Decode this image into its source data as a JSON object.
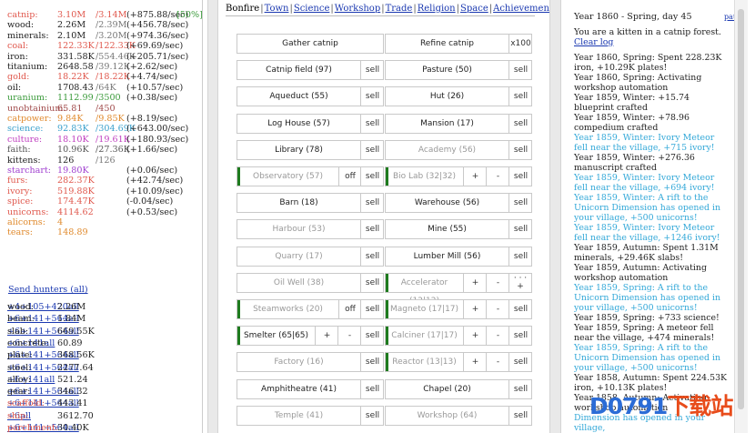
{
  "resources": [
    {
      "name": "catnip",
      "value": "3.10M",
      "max": "/3.14M",
      "rate": "(+875.88/sec)",
      "pct": "[50%]",
      "color": "#e0584d"
    },
    {
      "name": "wood",
      "value": "2.26M",
      "max": "/2.39M",
      "rate": "(+456.78/sec)",
      "pct": "",
      "color": "#222"
    },
    {
      "name": "minerals",
      "value": "2.10M",
      "max": "/3.20M",
      "rate": "(+974.36/sec)",
      "pct": "",
      "color": "#222"
    },
    {
      "name": "coal",
      "value": "122.33K",
      "max": "/122.33K",
      "rate": "(+69.69/sec)",
      "pct": "",
      "color": "#e0584d"
    },
    {
      "name": "iron",
      "value": "331.58K",
      "max": "/554.46K",
      "rate": "(+205.71/sec)",
      "pct": "",
      "color": "#222"
    },
    {
      "name": "titanium",
      "value": "2648.58",
      "max": "/39.12K",
      "rate": "(+2.62/sec)",
      "pct": "",
      "color": "#222"
    },
    {
      "name": "gold",
      "value": "18.22K",
      "max": "/18.22K",
      "rate": "(+4.74/sec)",
      "pct": "",
      "color": "#e0584d"
    },
    {
      "name": "oil",
      "value": "1708.43",
      "max": "/64K",
      "rate": "(+10.57/sec)",
      "pct": "",
      "color": "#222"
    },
    {
      "name": "uranium",
      "value": "1112.99",
      "max": "/3500",
      "rate": "(+0.38/sec)",
      "pct": "",
      "color": "#3a9a3a"
    },
    {
      "name": "unobtainium",
      "value": "65.81",
      "max": "/450",
      "rate": "",
      "pct": "",
      "color": "#a04a4a"
    },
    {
      "name": "catpower",
      "value": "9.84K",
      "max": "/9.85K",
      "rate": "(+8.19/sec)",
      "pct": "",
      "color": "#e08a2d"
    },
    {
      "name": "science",
      "value": "92.83K",
      "max": "/304.69K",
      "rate": "(+643.00/sec)",
      "pct": "",
      "color": "#3aa0cc"
    },
    {
      "name": "culture",
      "value": "18.10K",
      "max": "/19.61K",
      "rate": "(+180.93/sec)",
      "pct": "",
      "color": "#c040c0"
    },
    {
      "name": "faith",
      "value": "10.96K",
      "max": "/27.36K",
      "rate": "(+1.66/sec)",
      "pct": "",
      "color": "#555"
    },
    {
      "name": "kittens",
      "value": "126",
      "max": "/126",
      "rate": "",
      "pct": "",
      "color": "#222"
    },
    {
      "name": "starchart",
      "value": "19.80K",
      "max": "",
      "rate": "(+0.06/sec)",
      "pct": "",
      "color": "#a040d0"
    },
    {
      "name": "furs",
      "value": "282.37K",
      "max": "",
      "rate": "(+42.74/sec)",
      "pct": "",
      "color": "#e0584d"
    },
    {
      "name": "ivory",
      "value": "519.88K",
      "max": "",
      "rate": "(+10.09/sec)",
      "pct": "",
      "color": "#e0584d"
    },
    {
      "name": "spice",
      "value": "174.47K",
      "max": "",
      "rate": "(-0.04/sec)",
      "pct": "",
      "color": "#e0584d"
    },
    {
      "name": "unicorns",
      "value": "4114.62",
      "max": "",
      "rate": "(+0.53/sec)",
      "pct": "",
      "color": "#e0584d"
    },
    {
      "name": "alicorns",
      "value": "4",
      "max": "",
      "rate": "",
      "pct": "",
      "color": "#e08a2d"
    },
    {
      "name": "tears",
      "value": "148.89",
      "max": "",
      "rate": "",
      "pct": "",
      "color": "#e08a2d"
    }
  ],
  "send_hunters": "Send hunters (all)",
  "crafted": [
    {
      "name": "wood",
      "value": "2.26M",
      "a1": "+4",
      "a2": "+105",
      "a3": "+420",
      "a4": "all",
      "color": "#222"
    },
    {
      "name": "beam",
      "value": "1.84M",
      "a1": "+6",
      "a2": "+141",
      "a3": "+564",
      "a4": "all",
      "color": "#222"
    },
    {
      "name": "slab",
      "value": "669.55K",
      "a1": "+6",
      "a2": "+141",
      "a3": "+564",
      "a4": "all",
      "color": "#222"
    },
    {
      "name": "concrete",
      "value": "60.89",
      "a1": "+6",
      "a2": "+141",
      "a3": "",
      "a4": "all",
      "color": "#222"
    },
    {
      "name": "plate",
      "value": "368.56K",
      "a1": "+6",
      "a2": "+141",
      "a3": "+564",
      "a4": "all",
      "color": "#222"
    },
    {
      "name": "steel",
      "value": "2277.64",
      "a1": "+6",
      "a2": "+141",
      "a3": "+564",
      "a4": "all",
      "color": "#222"
    },
    {
      "name": "alloy",
      "value": "521.24",
      "a1": "+6",
      "a2": "+141",
      "a3": "",
      "a4": "all",
      "color": "#222"
    },
    {
      "name": "gear",
      "value": "346.32",
      "a1": "+6",
      "a2": "+141",
      "a3": "+564",
      "a4": "all",
      "color": "#222"
    },
    {
      "name": "scaffold",
      "value": "443.41",
      "a1": "+6",
      "a2": "+141",
      "a3": "+564",
      "a4": "all",
      "color": "#e0584d"
    },
    {
      "name": "ship",
      "value": "3612.70",
      "a1": "+6",
      "a2": "",
      "a3": "",
      "a4": "all",
      "color": "#e0584d"
    },
    {
      "name": "parchment",
      "value": "30.40K",
      "a1": "+6",
      "a2": "+141",
      "a3": "+564",
      "a4": "all",
      "color": "#e0584d"
    }
  ],
  "tabs": [
    "Bonfire",
    "Town",
    "Science",
    "Workshop",
    "Trade",
    "Religion",
    "Space",
    "Achievements"
  ],
  "buildings": [
    {
      "label": "Gather catnip",
      "col": 0,
      "row": 0,
      "dis": false,
      "bar": false,
      "ctl": []
    },
    {
      "label": "Refine catnip",
      "col": 1,
      "row": 0,
      "dis": false,
      "bar": false,
      "ctl": [
        "x100"
      ]
    },
    {
      "label": "Catnip field (97)",
      "col": 0,
      "row": 1,
      "dis": false,
      "bar": false,
      "ctl": [
        "sell"
      ]
    },
    {
      "label": "Pasture (50)",
      "col": 1,
      "row": 1,
      "dis": false,
      "bar": false,
      "ctl": [
        "sell"
      ]
    },
    {
      "label": "Aqueduct (55)",
      "col": 0,
      "row": 2,
      "dis": false,
      "bar": false,
      "ctl": [
        "sell"
      ]
    },
    {
      "label": "Hut (26)",
      "col": 1,
      "row": 2,
      "dis": false,
      "bar": false,
      "ctl": [
        "sell"
      ]
    },
    {
      "label": "Log House (57)",
      "col": 0,
      "row": 3,
      "dis": false,
      "bar": false,
      "ctl": [
        "sell"
      ]
    },
    {
      "label": "Mansion (17)",
      "col": 1,
      "row": 3,
      "dis": false,
      "bar": false,
      "ctl": [
        "sell"
      ]
    },
    {
      "label": "Library (78)",
      "col": 0,
      "row": 4,
      "dis": false,
      "bar": false,
      "ctl": [
        "sell"
      ]
    },
    {
      "label": "Academy (56)",
      "col": 1,
      "row": 4,
      "dis": true,
      "bar": false,
      "ctl": [
        "sell"
      ]
    },
    {
      "label": "Observatory (57)",
      "col": 0,
      "row": 5,
      "dis": true,
      "bar": true,
      "ctl": [
        "off",
        "sell"
      ]
    },
    {
      "label": "Bio Lab (32|32)",
      "col": 1,
      "row": 5,
      "dis": true,
      "bar": true,
      "ctl": [
        "+",
        "-",
        "sell"
      ]
    },
    {
      "label": "Barn (18)",
      "col": 0,
      "row": 6,
      "dis": false,
      "bar": false,
      "ctl": [
        "sell"
      ]
    },
    {
      "label": "Warehouse (56)",
      "col": 1,
      "row": 6,
      "dis": false,
      "bar": false,
      "ctl": [
        "sell"
      ]
    },
    {
      "label": "Harbour (53)",
      "col": 0,
      "row": 7,
      "dis": true,
      "bar": false,
      "ctl": [
        "sell"
      ]
    },
    {
      "label": "Mine (55)",
      "col": 1,
      "row": 7,
      "dis": false,
      "bar": false,
      "ctl": [
        "sell"
      ]
    },
    {
      "label": "Quarry (17)",
      "col": 0,
      "row": 8,
      "dis": true,
      "bar": false,
      "ctl": [
        "sell"
      ]
    },
    {
      "label": "Lumber Mill (56)",
      "col": 1,
      "row": 8,
      "dis": false,
      "bar": false,
      "ctl": [
        "sell"
      ]
    },
    {
      "label": "Oil Well (38)",
      "col": 0,
      "row": 9,
      "dis": true,
      "bar": false,
      "ctl": [
        "sell"
      ]
    },
    {
      "label": "Accelerator (12|12)",
      "col": 1,
      "row": 9,
      "dis": true,
      "bar": true,
      "ctl": [
        "+",
        "-",
        "· · · +"
      ]
    },
    {
      "label": "Steamworks (20)",
      "col": 0,
      "row": 10,
      "dis": true,
      "bar": true,
      "ctl": [
        "off",
        "sell"
      ]
    },
    {
      "label": "Magneto (17|17)",
      "col": 1,
      "row": 10,
      "dis": true,
      "bar": true,
      "ctl": [
        "+",
        "-",
        "sell"
      ]
    },
    {
      "label": "Smelter (65|65)",
      "col": 0,
      "row": 11,
      "dis": false,
      "bar": true,
      "ctl": [
        "+",
        "-",
        "sell"
      ]
    },
    {
      "label": "Calciner (17|17)",
      "col": 1,
      "row": 11,
      "dis": true,
      "bar": true,
      "ctl": [
        "+",
        "-",
        "sell"
      ]
    },
    {
      "label": "Factory (16)",
      "col": 0,
      "row": 12,
      "dis": true,
      "bar": false,
      "ctl": [
        "sell"
      ]
    },
    {
      "label": "Reactor (13|13)",
      "col": 1,
      "row": 12,
      "dis": true,
      "bar": true,
      "ctl": [
        "+",
        "-",
        "sell"
      ]
    },
    {
      "label": "Amphitheatre (41)",
      "col": 0,
      "row": 13,
      "dis": false,
      "bar": false,
      "ctl": [
        "sell"
      ]
    },
    {
      "label": "Chapel (20)",
      "col": 1,
      "row": 13,
      "dis": false,
      "bar": false,
      "ctl": [
        "sell"
      ]
    },
    {
      "label": "Temple (41)",
      "col": 0,
      "row": 14,
      "dis": true,
      "bar": false,
      "ctl": [
        "sell"
      ]
    },
    {
      "label": "Workshop (64)",
      "col": 1,
      "row": 14,
      "dis": true,
      "bar": false,
      "ctl": [
        "sell"
      ]
    }
  ],
  "log": {
    "date": "Year 1860 - Spring, day 45",
    "pause": "pause",
    "intro": "You are a kitten in a catnip forest.",
    "clear": "Clear log",
    "entries": [
      {
        "text": "Year 1860, Spring: Spent 228.23K iron, +10.29K plates!",
        "cyan": false
      },
      {
        "text": "Year 1860, Spring: Activating workshop automation",
        "cyan": false
      },
      {
        "text": "Year 1859, Winter: +15.74 blueprint crafted",
        "cyan": false
      },
      {
        "text": "Year 1859, Winter: +78.96 compedium crafted",
        "cyan": false
      },
      {
        "text": "Year 1859, Winter: Ivory Meteor fell near the village, +715 ivory!",
        "cyan": true
      },
      {
        "text": "Year 1859, Winter: +276.36 manuscript crafted",
        "cyan": false
      },
      {
        "text": "Year 1859, Winter: Ivory Meteor fell near the village, +694 ivory!",
        "cyan": true
      },
      {
        "text": "Year 1859, Winter: A rift to the Unicorn Dimension has opened in your village, +500 unicorns!",
        "cyan": true
      },
      {
        "text": "Year 1859, Winter: Ivory Meteor fell near the village, +1246 ivory!",
        "cyan": true
      },
      {
        "text": "Year 1859, Autumn: Spent 1.31M minerals, +29.46K slabs!",
        "cyan": false
      },
      {
        "text": "Year 1859, Autumn: Activating workshop automation",
        "cyan": false
      },
      {
        "text": "Year 1859, Spring: A rift to the Unicorn Dimension has opened in your village, +500 unicorns!",
        "cyan": true
      },
      {
        "text": "Year 1859, Spring: +733 science!",
        "cyan": false
      },
      {
        "text": "Year 1859, Spring: A meteor fell near the village, +474 minerals!",
        "cyan": false
      },
      {
        "text": "Year 1859, Spring: A rift to the Unicorn Dimension has opened in your village, +500 unicorns!",
        "cyan": true
      },
      {
        "text": "Year 1858, Autumn: Spent 224.53K iron, +10.13K plates!",
        "cyan": false
      },
      {
        "text": "Year 1858, Autumn: Activating workshop automation",
        "cyan": false
      },
      {
        "text": "Dimension has opened in your village,",
        "cyan": true
      }
    ]
  },
  "watermark": {
    "left": "D0791",
    "right": "下载站"
  }
}
